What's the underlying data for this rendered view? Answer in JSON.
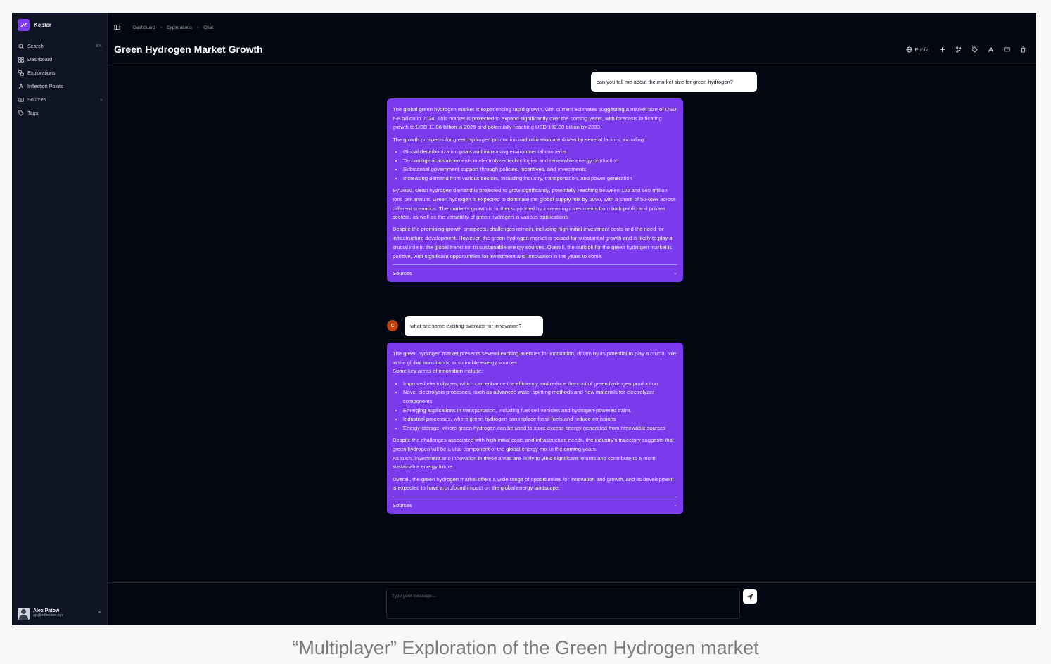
{
  "app": {
    "name": "Kepler"
  },
  "sidebar": {
    "items": [
      {
        "label": "Search",
        "shortcut": "⌘K",
        "icon": "search-icon"
      },
      {
        "label": "Dashboard",
        "icon": "dashboard-icon"
      },
      {
        "label": "Explorations",
        "icon": "explorations-icon"
      },
      {
        "label": "Inflection Points",
        "icon": "inflection-icon"
      },
      {
        "label": "Sources",
        "icon": "book-icon"
      },
      {
        "label": "Tags",
        "icon": "tag-icon"
      }
    ]
  },
  "user": {
    "name": "Alex Patow",
    "email": "ap@inflection.xyz"
  },
  "breadcrumb": [
    "Dashboard",
    "Explorations",
    "Chat"
  ],
  "page": {
    "title": "Green Hydrogen Market Growth"
  },
  "toolbar": {
    "visibility_label": "Public"
  },
  "conversation": {
    "q1": "can you tell me about the market size for green hydrogen?",
    "a1": {
      "p1": "The global green hydrogen market is experiencing rapid growth, with current estimates suggesting a market size of USD 6-8 billion in 2024. This market is projected to expand significantly over the coming years, with forecasts indicating growth to USD 11.86 billion in 2025 and potentially reaching USD 192.30 billion by 2033.",
      "p2": "The growth prospects for green hydrogen production and utilization are driven by several factors, including:",
      "bullets": [
        "Global decarbonization goals and increasing environmental concerns",
        "Technological advancements in electrolyzer technologies and renewable energy production",
        "Substantial government support through policies, incentives, and investments",
        "Increasing demand from various sectors, including industry, transportation, and power generation"
      ],
      "p3": "By 2050, clean hydrogen demand is projected to grow significantly, potentially reaching between 125 and 585 million tons per annum. Green hydrogen is expected to dominate the global supply mix by 2050, with a share of 50-65% across different scenarios. The market's growth is further supported by increasing investments from both public and private sectors, as well as the versatility of green hydrogen in various applications.",
      "p4": "Despite the promising growth prospects, challenges remain, including high initial investment costs and the need for infrastructure development. However, the green hydrogen market is poised for substantial growth and is likely to play a crucial role in the global transition to sustainable energy sources. Overall, the outlook for the green hydrogen market is positive, with significant opportunities for investment and innovation in the years to come.",
      "sources_label": "Sources"
    },
    "q2_user_initial": "C",
    "q2": "what are some exciting avenues for innovation?",
    "a2": {
      "p1a": "The green hydrogen market presents several exciting avenues for innovation, driven by its potential to play a crucial role in the global transition to sustainable energy sources.",
      "p1b": "Some key areas of innovation include:",
      "bullets": [
        "Improved electrolyzers, which can enhance the efficiency and reduce the cost of green hydrogen production",
        "Novel electrolysis processes, such as advanced water splitting methods and new materials for electrolyzer components",
        "Emerging applications in transportation, including fuel cell vehicles and hydrogen-powered trains",
        "Industrial processes, where green hydrogen can replace fossil fuels and reduce emissions",
        "Energy storage, where green hydrogen can be used to store excess energy generated from renewable sources"
      ],
      "p2a": "Despite the challenges associated with high initial costs and infrastructure needs, the industry's trajectory suggests that green hydrogen will be a vital component of the global energy mix in the coming years.",
      "p2b": "As such, investment and innovation in these areas are likely to yield significant returns and contribute to a more sustainable energy future.",
      "p3": "Overall, the green hydrogen market offers a wide range of opportunities for innovation and growth, and its development is expected to have a profound impact on the global energy landscape.",
      "sources_label": "Sources"
    }
  },
  "composer": {
    "placeholder": "Type your message..."
  },
  "caption": "“Multiplayer” Exploration of the Green Hydrogen market",
  "colors": {
    "accent": "#7c3aed",
    "background": "#030712",
    "sidebar": "#0f1524",
    "user_badge": "#c2410c"
  }
}
